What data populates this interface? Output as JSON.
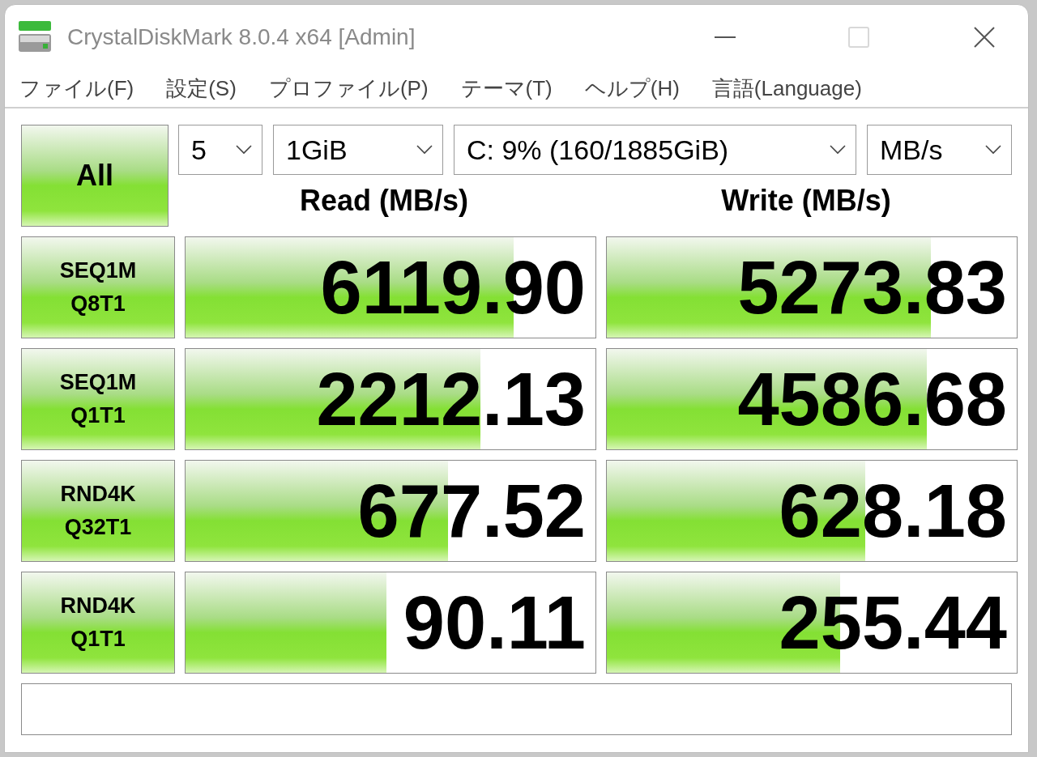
{
  "window": {
    "title": "CrystalDiskMark 8.0.4 x64 [Admin]",
    "maximize_disabled": true
  },
  "menu": [
    "ファイル(F)",
    "設定(S)",
    "プロファイル(P)",
    "テーマ(T)",
    "ヘルプ(H)",
    "言語(Language)"
  ],
  "all_button": "All",
  "selectors": [
    {
      "value": "5"
    },
    {
      "value": "1GiB"
    },
    {
      "value": "C: 9% (160/1885GiB)"
    },
    {
      "value": "MB/s"
    }
  ],
  "headers": [
    "Read (MB/s)",
    "Write (MB/s)"
  ],
  "rows": [
    {
      "label": [
        "SEQ1M",
        "Q8T1"
      ],
      "read": {
        "value": "6119.90",
        "level": 0.8
      },
      "write": {
        "value": "5273.83",
        "level": 0.79
      }
    },
    {
      "label": [
        "SEQ1M",
        "Q1T1"
      ],
      "read": {
        "value": "2212.13",
        "level": 0.72
      },
      "write": {
        "value": "4586.68",
        "level": 0.78
      }
    },
    {
      "label": [
        "RND4K",
        "Q32T1"
      ],
      "read": {
        "value": "677.52",
        "level": 0.64
      },
      "write": {
        "value": "628.18",
        "level": 0.63
      }
    },
    {
      "label": [
        "RND4K",
        "Q1T1"
      ],
      "read": {
        "value": "90.11",
        "level": 0.49
      },
      "write": {
        "value": "255.44",
        "level": 0.57
      }
    }
  ]
}
